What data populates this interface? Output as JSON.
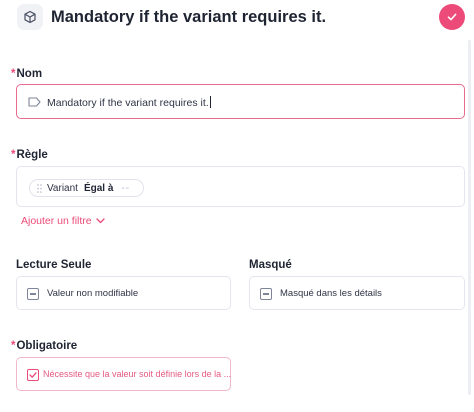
{
  "header": {
    "title": "Mandatory if the variant requires it.",
    "cube_icon": "cube-icon",
    "save_icon": "check-icon"
  },
  "nom": {
    "label": "Nom",
    "value": "Mandatory if the variant requires it.",
    "icon": "tag-icon"
  },
  "regle": {
    "label": "Règle",
    "filter": {
      "field": "Variant",
      "operator": "Égal à",
      "value": "--"
    },
    "add_filter_label": "Ajouter un filtre"
  },
  "lecture_seule": {
    "label": "Lecture Seule",
    "option_label": "Valeur non modifiable",
    "checked": false
  },
  "masque": {
    "label": "Masqué",
    "option_label": "Masqué dans les détails",
    "checked": false
  },
  "obligatoire": {
    "label": "Obligatoire",
    "option_label": "Nécessite que la valeur soit définie lors de la ...",
    "checked": true
  },
  "colors": {
    "accent": "#ec4b79",
    "text": "#1f2433",
    "border": "#e4e6ee"
  }
}
